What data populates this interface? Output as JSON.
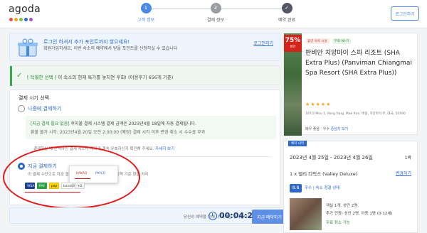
{
  "header": {
    "logo": "agoda",
    "dot_colors": [
      "#e84d3d",
      "#f5a623",
      "#7bc043",
      "#2e69c9",
      "#9b59b6"
    ],
    "steps": [
      {
        "num": "1",
        "label": "고객 정보"
      },
      {
        "num": "2",
        "label": "결제 정보"
      },
      {
        "num": "✓",
        "label": "예약 완료"
      }
    ],
    "login_label": "로그인하기"
  },
  "promo": {
    "title": "로그인 하셔서 추가 포인트까지 쌓으세요!",
    "body": "회원가입하세요, 이번 숙소의 예약에서 받을 포인트를 신청하실 수 있습니다",
    "link": "로그인하기"
  },
  "notice": {
    "tag": "[ 탁월한 선택 ]",
    "text": "이 숙소의 현재 특가를 놓치면 후회! (이용후기 656개 기준)"
  },
  "payment": {
    "title": "결제 시기 선택",
    "option_later": "나중에 결제하기",
    "later_tag": "[지금 결제 필요 없음]",
    "later_line1": "후지불 결제 시스템 결제 금액은 2023년4월 18일에 자동 결제됩니다.",
    "later_line2": "환불 불가 시각: 2023년4월 20일 오전 2:00:00 (예정) 결제 시각 이후 변경·취소 시 수수료 부과",
    "small_note_a": "결제하실 때 선택하신 결제 카드나 계좌가 계속 유효하신지 확인해 주세요.",
    "small_note_link": "자세히 보기",
    "option_now": "지금 결제하기",
    "option_now_sub": "이 결제 수단으로 지금 결제하세요. 결제 취소 시 개별 정책 기준 환불 처리",
    "popup_a": "KAKAO",
    "popup_b": "PAYCO",
    "cards": [
      "VISA",
      "PAY",
      "pay",
      "banking",
      "+2"
    ]
  },
  "timer": {
    "label": "당신의 예약을 위해 이 가격은 유지됩니다",
    "time": "00:04:24",
    "button": "지금 예약하기"
  },
  "hotel": {
    "discount_pct": "75%",
    "discount_off": "할인",
    "badge1": "휴양 숙박 시설",
    "badge2": "무료 Wi-Fi",
    "name": "판비안 치앙마이 스파 리조트 (SHA Extra Plus) (Panviman Chiangmai Spa Resort (SHA Extra Plus))",
    "stars": "★★★★★",
    "address": "197/2 Moo 1, Pong Yang, Mae Rim, 매림, 치앙마이 주, 태국, 50180",
    "meta": "매우 좋음 · 우수",
    "meta_link": "중심지 보기"
  },
  "booking": {
    "tag": "예약 내역",
    "dates": "2023년 4월 25일 - 2023년 4월 26일",
    "nights": "1박",
    "room": "1 x 밸리 디럭스 (Valley Deluxe)",
    "room_link": "변경하기",
    "score": "8.8",
    "score_text": "우수 | 숙소 청결 상태",
    "info1": "객실 1개, 성인 2명",
    "info2": "추가 인원: 성인 2명, 아동 1명 (0-12세)",
    "info3": "무료 취소 가능"
  }
}
